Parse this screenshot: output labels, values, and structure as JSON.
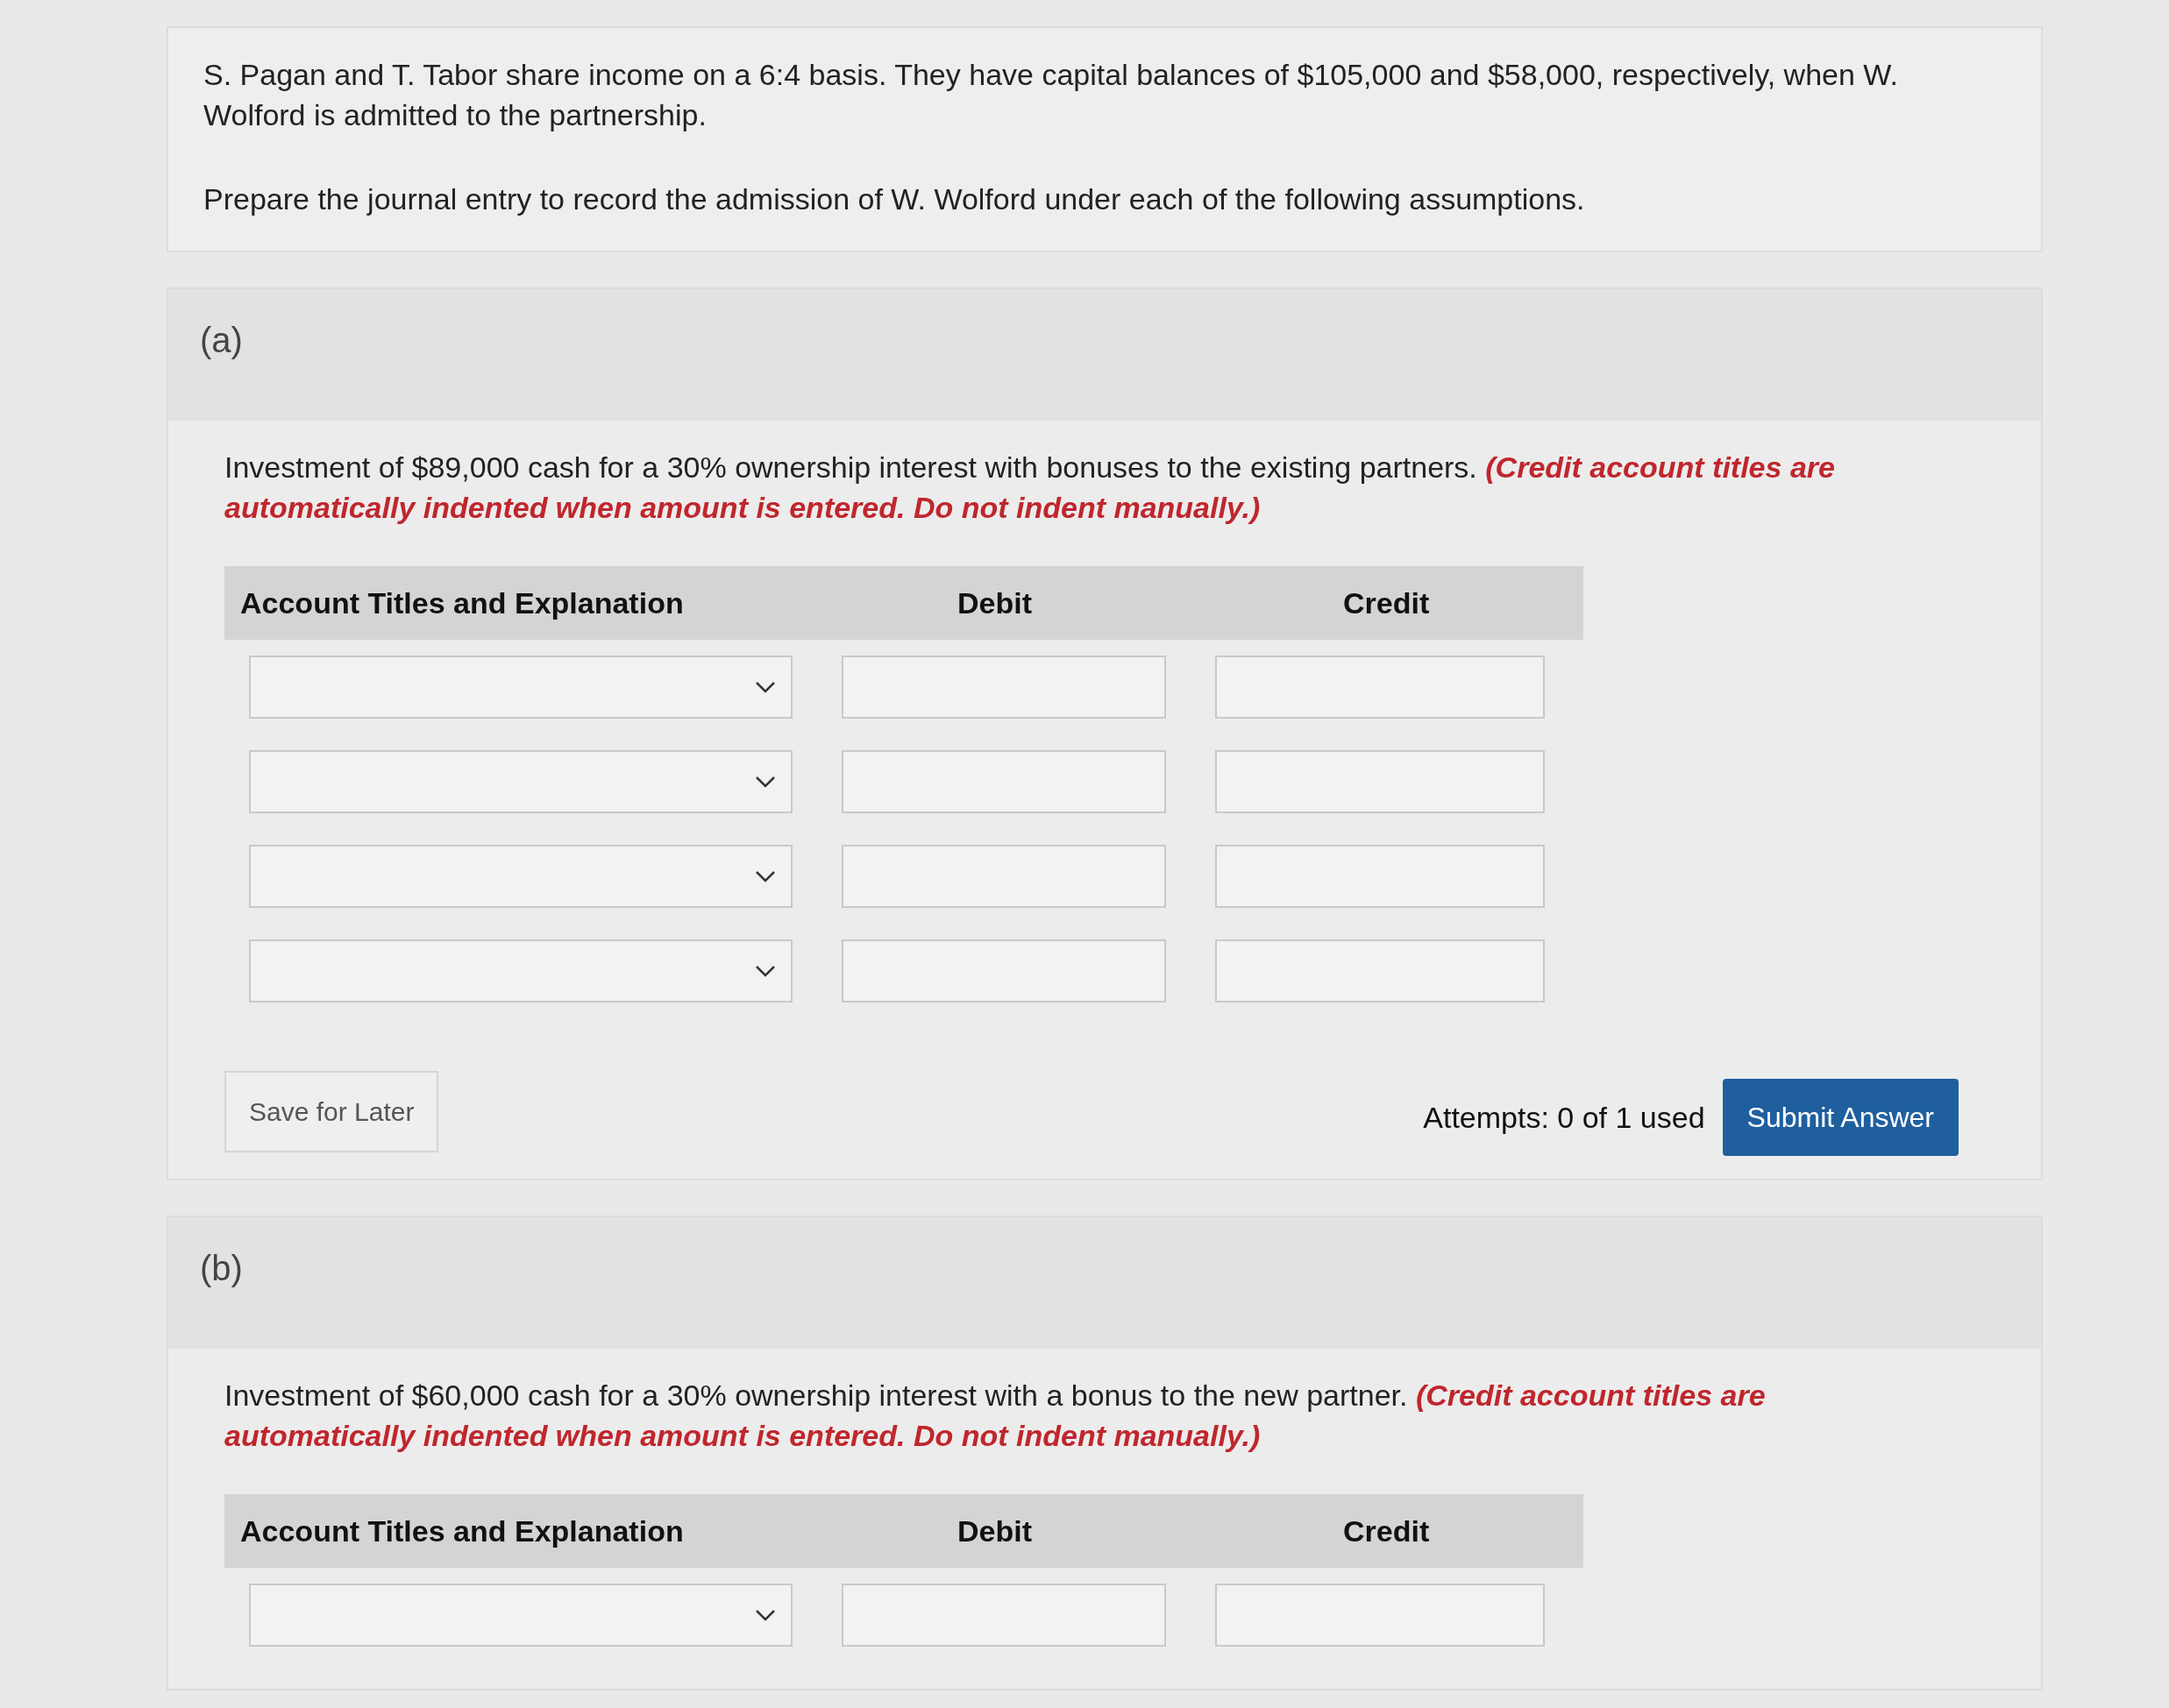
{
  "intro": {
    "text": "S. Pagan and T. Tabor share income on a 6:4 basis. They have capital balances of $105,000 and $58,000, respectively, when W. Wolford is admitted to the partnership.",
    "instruction": "Prepare the journal entry to record the admission of W. Wolford under each of the following assumptions."
  },
  "parts": [
    {
      "label": "(a)",
      "question": "Investment of $89,000 cash for a 30% ownership interest with bonuses to the existing partners.",
      "note": "(Credit account titles are automatically indented when amount is entered. Do not indent manually.)",
      "columns": [
        "Account Titles and Explanation",
        "Debit",
        "Credit"
      ],
      "rows": [
        {
          "kind": "entry"
        },
        {
          "kind": "entry"
        },
        {
          "kind": "entry"
        },
        {
          "kind": "entry"
        }
      ],
      "save_button": "Save for Later",
      "attempts": "Attempts: 0 of 1 used",
      "submit_button": "Submit Answer"
    },
    {
      "label": "(b)",
      "question": "Investment of $60,000 cash for a 30% ownership interest with a bonus to the new partner.",
      "note": "(Credit account titles are automatically indented when amount is entered. Do not indent manually.)",
      "columns": [
        "Account Titles and Explanation",
        "Debit",
        "Credit"
      ],
      "rows": [
        {
          "kind": "entry"
        }
      ]
    }
  ]
}
